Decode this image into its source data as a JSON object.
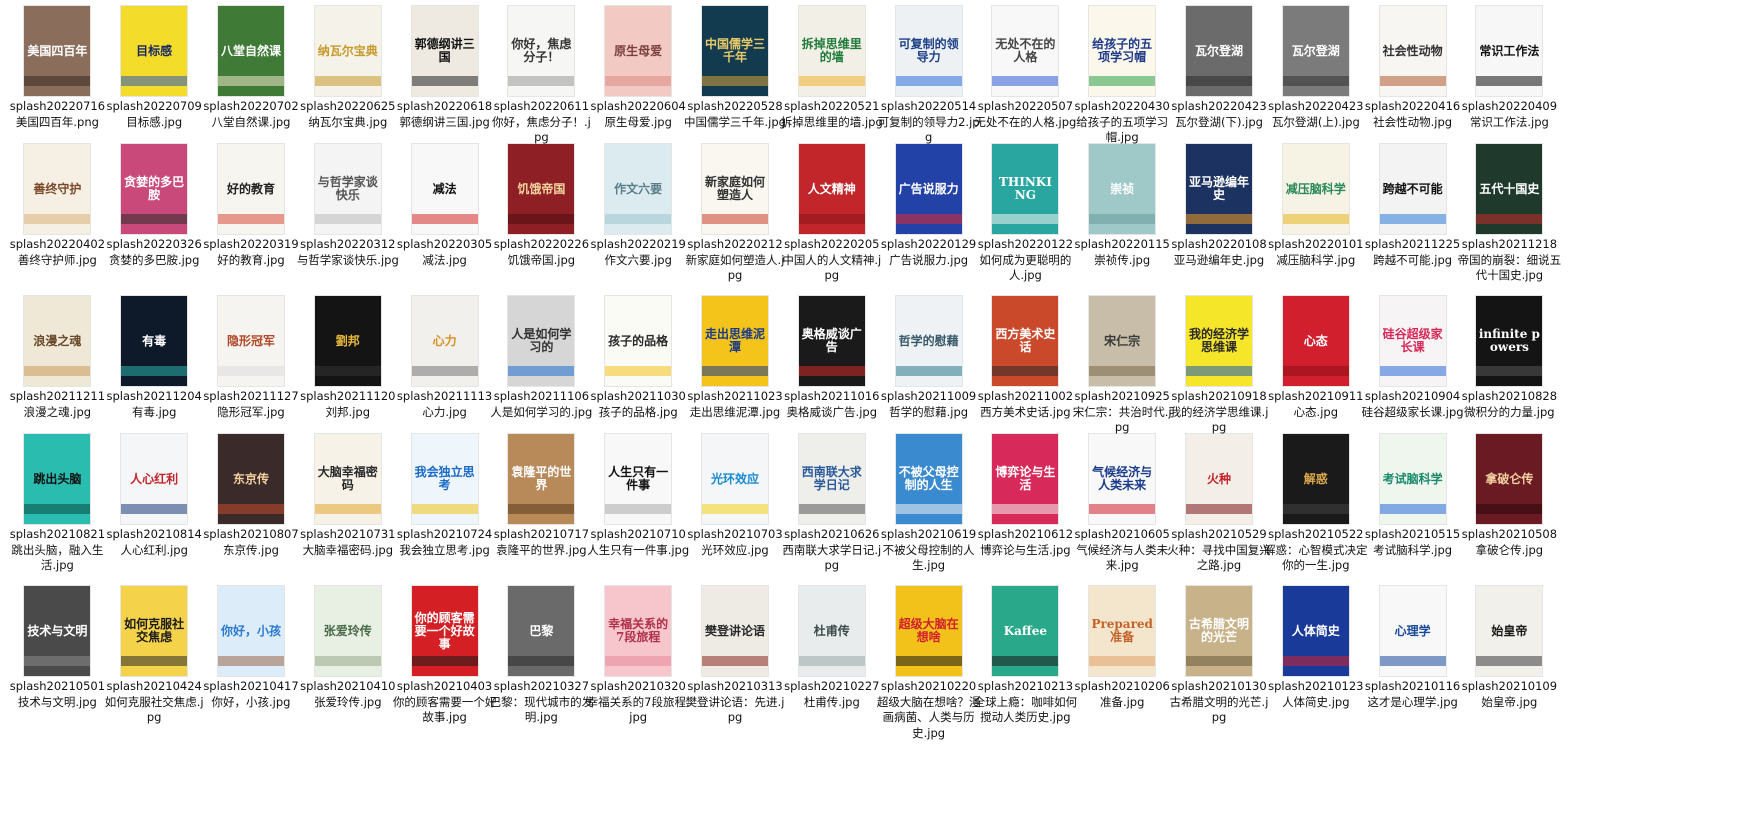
{
  "view": {
    "name": "file-grid",
    "row_count": 5,
    "column_count": 16
  },
  "files": [
    {
      "name": "splash20220716美国四百年.png",
      "cover_text": "美国四百年",
      "bg": "#8a6d5b",
      "fg": "#ffffff",
      "band": "#3b2a22"
    },
    {
      "name": "splash20220709目标感.jpg",
      "cover_text": "目标感",
      "bg": "#f3dc2a",
      "fg": "#1a2a66",
      "band": "#2a58b8"
    },
    {
      "name": "splash20220702八堂自然课.jpg",
      "cover_text": "八堂自然课",
      "bg": "#3f7a36",
      "fg": "#ffffff",
      "band": "#f2e8c8"
    },
    {
      "name": "splash20220625纳瓦尔宝典.jpg",
      "cover_text": "纳瓦尔宝典",
      "bg": "#f5f2ea",
      "fg": "#c79a2c",
      "band": "#c79a2c"
    },
    {
      "name": "splash20220618郭德纲讲三国.jpg",
      "cover_text": "郭德纲讲三国",
      "bg": "#eeeae2",
      "fg": "#111111",
      "band": "#222222"
    },
    {
      "name": "splash20220611你好，焦虑分子！.jpg",
      "cover_text": "你好，焦虑分子！",
      "bg": "#f6f6f4",
      "fg": "#333333",
      "band": "#999999"
    },
    {
      "name": "splash20220604原生母爱.jpg",
      "cover_text": "原生母爱",
      "bg": "#f3c9c4",
      "fg": "#7a3f3c",
      "band": "#d98a84"
    },
    {
      "name": "splash20220528中国儒学三千年.jpg",
      "cover_text": "中国儒学三千年",
      "bg": "#123b4f",
      "fg": "#e8c96a",
      "band": "#d9a23a"
    },
    {
      "name": "splash20220521拆掉思维里的墙.jpg",
      "cover_text": "拆掉思维里的墙",
      "bg": "#f1efe6",
      "fg": "#1f7b3a",
      "band": "#f0b22a"
    },
    {
      "name": "splash20220514可复制的领导力2.jpg",
      "cover_text": "可复制的领导力",
      "bg": "#eef1f4",
      "fg": "#1c3f86",
      "band": "#2b6fd8"
    },
    {
      "name": "splash20220507无处不在的人格.jpg",
      "cover_text": "无处不在的人格",
      "bg": "#f8f8f8",
      "fg": "#444444",
      "band": "#2f5bd2"
    },
    {
      "name": "splash20220430给孩子的五项学习帽.jpg",
      "cover_text": "给孩子的五项学习帽",
      "bg": "#fbf7ea",
      "fg": "#1e3a8a",
      "band": "#2ea04a"
    },
    {
      "name": "splash20220423瓦尔登湖(下).jpg",
      "cover_text": "瓦尔登湖",
      "bg": "#6b6b6b",
      "fg": "#ffffff",
      "band": "#2c2c2c"
    },
    {
      "name": "splash20220423瓦尔登湖(上).jpg",
      "cover_text": "瓦尔登湖",
      "bg": "#7b7b7b",
      "fg": "#ffffff",
      "band": "#333333"
    },
    {
      "name": "splash20220416社会性动物.jpg",
      "cover_text": "社会性动物",
      "bg": "#f8f6f2",
      "fg": "#333333",
      "band": "#b05a2e"
    },
    {
      "name": "splash20220409常识工作法.jpg",
      "cover_text": "常识工作法",
      "bg": "#f7f7f7",
      "fg": "#111111",
      "band": "#111111"
    },
    {
      "name": "splash20220402善终守护师.jpg",
      "cover_text": "善终守护",
      "bg": "#f6efe4",
      "fg": "#7a4a2a",
      "band": "#d9b27a"
    },
    {
      "name": "splash20220326贪婪的多巴胺.jpg",
      "cover_text": "贪婪的多巴胺",
      "bg": "#c9497a",
      "fg": "#ffffff",
      "band": "#2b2b2b"
    },
    {
      "name": "splash20220319好的教育.jpg",
      "cover_text": "好的教育",
      "bg": "#f7f5f0",
      "fg": "#222222",
      "band": "#d84a3a"
    },
    {
      "name": "splash20220312与哲学家谈快乐.jpg",
      "cover_text": "与哲学家谈快乐",
      "bg": "#f4f4f4",
      "fg": "#555555",
      "band": "#bbbbbb"
    },
    {
      "name": "splash20220305减法.jpg",
      "cover_text": "减法",
      "bg": "#f8f8f8",
      "fg": "#111111",
      "band": "#d42a2a"
    },
    {
      "name": "splash20220226饥饿帝国.jpg",
      "cover_text": "饥饿帝国",
      "bg": "#8e1f24",
      "fg": "#f2d5a0",
      "band": "#4a0d10"
    },
    {
      "name": "splash20220219作文六要.jpg",
      "cover_text": "作文六要",
      "bg": "#dcebf0",
      "fg": "#5a7d8a",
      "band": "#9cc4d0"
    },
    {
      "name": "splash20220212新家庭如何塑造人.jpg",
      "cover_text": "新家庭如何塑造人",
      "bg": "#faf6f0",
      "fg": "#333333",
      "band": "#c9402a"
    },
    {
      "name": "splash20220205中国人的人文精神.jpg",
      "cover_text": "人文精神",
      "bg": "#c2262a",
      "fg": "#ffffff",
      "band": "#8a1418"
    },
    {
      "name": "splash20220129广告说服力.jpg",
      "cover_text": "广告说服力",
      "bg": "#2242a8",
      "fg": "#ffffff",
      "band": "#e2282e"
    },
    {
      "name": "splash20220122如何成为更聪明的人.jpg",
      "cover_text": "THINKING",
      "bg": "#2aa6a0",
      "fg": "#ffffff",
      "band": "#f2f2f2"
    },
    {
      "name": "splash20220115崇祯传.jpg",
      "cover_text": "崇祯",
      "bg": "#9fc8c8",
      "fg": "#ffffff",
      "band": "#6a9a9a"
    },
    {
      "name": "splash20220108亚马逊编年史.jpg",
      "cover_text": "亚马逊编年史",
      "bg": "#1c3260",
      "fg": "#ffffff",
      "band": "#f29a1e"
    },
    {
      "name": "splash20220101减压脑科学.jpg",
      "cover_text": "减压脑科学",
      "bg": "#f6f2e4",
      "fg": "#2a8a5a",
      "band": "#e6b822"
    },
    {
      "name": "splash20211225跨越不可能.jpg",
      "cover_text": "跨越不可能",
      "bg": "#f3f3f3",
      "fg": "#111111",
      "band": "#2b7ad8"
    },
    {
      "name": "splash20211218帝国的崩裂：细说五代十国史.jpg",
      "cover_text": "五代十国史",
      "bg": "#1f3a2c",
      "fg": "#ffffff",
      "band": "#c22a2a"
    },
    {
      "name": "splash20211211浪漫之魂.jpg",
      "cover_text": "浪漫之魂",
      "bg": "#efe8d6",
      "fg": "#6a4a2a",
      "band": "#c99a5a"
    },
    {
      "name": "splash20211204有毒.jpg",
      "cover_text": "有毒",
      "bg": "#0e1a2a",
      "fg": "#ffffff",
      "band": "#2ab0a8"
    },
    {
      "name": "splash20211127隐形冠军.jpg",
      "cover_text": "隐形冠军",
      "bg": "#f6f4f0",
      "fg": "#b04a2a",
      "band": "#dddddd"
    },
    {
      "name": "splash20211120刘邦.jpg",
      "cover_text": "劉邦",
      "bg": "#141414",
      "fg": "#e6b83a",
      "band": "#333333"
    },
    {
      "name": "splash20211113心力.jpg",
      "cover_text": "心力",
      "bg": "#f2f0ec",
      "fg": "#d6922a",
      "band": "#777777"
    },
    {
      "name": "splash20211106人是如何学习的.jpg",
      "cover_text": "人是如何学习的",
      "bg": "#d6d6d6",
      "fg": "#333333",
      "band": "#1f6fd0"
    },
    {
      "name": "splash20211030孩子的品格.jpg",
      "cover_text": "孩子的品格",
      "bg": "#fbfbf6",
      "fg": "#2a2a2a",
      "band": "#f2c21a"
    },
    {
      "name": "splash20211023走出思维泥潭.jpg",
      "cover_text": "走出思维泥潭",
      "bg": "#f4c41a",
      "fg": "#1a3a8a",
      "band": "#1a3a8a"
    },
    {
      "name": "splash20211016奥格威谈广告.jpg",
      "cover_text": "奥格威谈广告",
      "bg": "#1a1a1a",
      "fg": "#ffffff",
      "band": "#d42a2a"
    },
    {
      "name": "splash20211009哲学的慰藉.jpg",
      "cover_text": "哲学的慰藉",
      "bg": "#eef2f4",
      "fg": "#3a5a6a",
      "band": "#2a7a8a"
    },
    {
      "name": "splash20211002西方美术史话.jpg",
      "cover_text": "西方美术史话",
      "bg": "#c9492a",
      "fg": "#ffffff",
      "band": "#2a2a2a"
    },
    {
      "name": "splash20210925宋仁宗：共治时代.jpg",
      "cover_text": "宋仁宗",
      "bg": "#c7bda8",
      "fg": "#3a3a3a",
      "band": "#7a6a4a"
    },
    {
      "name": "splash20210918我的经济学思维课.jpg",
      "cover_text": "我的经济学思维课",
      "bg": "#f6e62a",
      "fg": "#2a2a2a",
      "band": "#1a5ab8"
    },
    {
      "name": "splash20210911心态.jpg",
      "cover_text": "心态",
      "bg": "#d21f2e",
      "fg": "#ffffff",
      "band": "#8a0f18"
    },
    {
      "name": "splash20210904硅谷超级家长课.jpg",
      "cover_text": "硅谷超级家长课",
      "bg": "#f6f4f4",
      "fg": "#d62a5a",
      "band": "#2a6ad8"
    },
    {
      "name": "splash20210828微积分的力量.jpg",
      "cover_text": "infinite powers",
      "bg": "#141414",
      "fg": "#ffffff",
      "band": "#555555"
    },
    {
      "name": "splash20210821跳出头脑，融入生活.jpg",
      "cover_text": "跳出头脑",
      "bg": "#2abcae",
      "fg": "#111111",
      "band": "#0a4a44"
    },
    {
      "name": "splash20210814人心红利.jpg",
      "cover_text": "人心红利",
      "bg": "#f4f6f8",
      "fg": "#c2262a",
      "band": "#1a3a7a"
    },
    {
      "name": "splash20210807东京传.jpg",
      "cover_text": "东京传",
      "bg": "#3a2a2a",
      "fg": "#f2d0a0",
      "band": "#c24a2a"
    },
    {
      "name": "splash20210731大脑幸福密码.jpg",
      "cover_text": "大脑幸福密码",
      "bg": "#f6f2e8",
      "fg": "#2a2a2a",
      "band": "#e2a82a"
    },
    {
      "name": "splash20210724我会独立思考.jpg",
      "cover_text": "我会独立思考",
      "bg": "#eef6fc",
      "fg": "#1a6ac8",
      "band": "#f2c21a"
    },
    {
      "name": "splash20210717袁隆平的世界.jpg",
      "cover_text": "袁隆平的世界",
      "bg": "#b88a5a",
      "fg": "#ffffff",
      "band": "#5a3a1a"
    },
    {
      "name": "splash20210710人生只有一件事.jpg",
      "cover_text": "人生只有一件事",
      "bg": "#f8f8f8",
      "fg": "#111111",
      "band": "#aaaaaa"
    },
    {
      "name": "splash20210703光环效应.jpg",
      "cover_text": "光环效应",
      "bg": "#f4f6f8",
      "fg": "#1a8ad0",
      "band": "#f2d21a"
    },
    {
      "name": "splash20210626西南联大求学日记.jpg",
      "cover_text": "西南联大求学日记",
      "bg": "#eeeeea",
      "fg": "#2a5a9a",
      "band": "#555555"
    },
    {
      "name": "splash20210619不被父母控制的人生.jpg",
      "cover_text": "不被父母控制的人生",
      "bg": "#3a8ad0",
      "fg": "#ffffff",
      "band": "#f2f2f2"
    },
    {
      "name": "splash20210612博弈论与生活.jpg",
      "cover_text": "博弈论与生活",
      "bg": "#d82a5a",
      "fg": "#ffffff",
      "band": "#f2f2f2"
    },
    {
      "name": "splash20210605气候经济与人类未来.jpg",
      "cover_text": "气候经济与人类未来",
      "bg": "#f8f8f8",
      "fg": "#1a3a8a",
      "band": "#d21f2e"
    },
    {
      "name": "splash20210529火种：寻找中国复兴之路.jpg",
      "cover_text": "火种",
      "bg": "#f4eee8",
      "fg": "#c2262a",
      "band": "#7a1418"
    },
    {
      "name": "splash20210522解惑：心智模式决定你的一生.jpg",
      "cover_text": "解惑",
      "bg": "#1a1a1a",
      "fg": "#d8a84a",
      "band": "#444444"
    },
    {
      "name": "splash20210515考试脑科学.jpg",
      "cover_text": "考试脑科学",
      "bg": "#eef6ee",
      "fg": "#1a8a6a",
      "band": "#2a6ad8"
    },
    {
      "name": "splash20210508拿破仑传.jpg",
      "cover_text": "拿破仑传",
      "bg": "#6a1a22",
      "fg": "#f2d0a0",
      "band": "#2a0a0e"
    },
    {
      "name": "splash20210501技术与文明.jpg",
      "cover_text": "技术与文明",
      "bg": "#4a4a4a",
      "fg": "#ffffff",
      "band": "#8a8a8a"
    },
    {
      "name": "splash20210424如何克服社交焦虑.jpg",
      "cover_text": "如何克服社交焦虑",
      "bg": "#f4d24a",
      "fg": "#1a1a1a",
      "band": "#2a2a2a"
    },
    {
      "name": "splash20210417你好，小孩.jpg",
      "cover_text": "你好，小孩",
      "bg": "#dcecf8",
      "fg": "#2a7ad0",
      "band": "#9a6a4a"
    },
    {
      "name": "splash20210410张爱玲传.jpg",
      "cover_text": "张爱玲传",
      "bg": "#e8f0e4",
      "fg": "#4a6a4a",
      "band": "#9aaa8a"
    },
    {
      "name": "splash20210403你的顾客需要一个好故事.jpg",
      "cover_text": "你的顾客需要一个好故事",
      "bg": "#d41f24",
      "fg": "#ffffff",
      "band": "#1a1a1a"
    },
    {
      "name": "splash20210327巴黎：现代城市的发明.jpg",
      "cover_text": "巴黎",
      "bg": "#6a6a6a",
      "fg": "#ffffff",
      "band": "#2a2a2a"
    },
    {
      "name": "splash20210320幸福关系的7段旅程.jpg",
      "cover_text": "幸福关系的7段旅程",
      "bg": "#f6c6cc",
      "fg": "#b0304a",
      "band": "#e88a9a"
    },
    {
      "name": "splash20210313樊登讲论语：先进.jpg",
      "cover_text": "樊登讲论语",
      "bg": "#eeeae4",
      "fg": "#2a2a2a",
      "band": "#8a2a22"
    },
    {
      "name": "splash20210227杜甫传.jpg",
      "cover_text": "杜甫传",
      "bg": "#e8ecec",
      "fg": "#3a4a4a",
      "band": "#9aaaaa"
    },
    {
      "name": "splash20210220超级大脑在想啥？漫画病菌、人类与历史.jpg",
      "cover_text": "超级大脑在想啥",
      "bg": "#f2c21a",
      "fg": "#d21f2e",
      "band": "#1a1a1a"
    },
    {
      "name": "splash20210213全球上瘾：咖啡如何搅动人类历史.jpg",
      "cover_text": "Kaffee",
      "bg": "#2aa88a",
      "fg": "#ffffff",
      "band": "#1a1a1a"
    },
    {
      "name": "splash20210206准备.jpg",
      "cover_text": "Prepared 准备",
      "bg": "#f4e6cc",
      "fg": "#c2622a",
      "band": "#e2a26a"
    },
    {
      "name": "splash20210130古希腊文明的光芒.jpg",
      "cover_text": "古希腊文明的光芒",
      "bg": "#c8b28a",
      "fg": "#ffffff",
      "band": "#6a5a3a"
    },
    {
      "name": "splash20210123人体简史.jpg",
      "cover_text": "人体简史",
      "bg": "#1a3a9a",
      "fg": "#ffffff",
      "band": "#d21f2e"
    },
    {
      "name": "splash20210116这才是心理学.jpg",
      "cover_text": "心理学",
      "bg": "#f8f8f8",
      "fg": "#1a4a9a",
      "band": "#1a4a9a"
    },
    {
      "name": "splash20210109始皇帝.jpg",
      "cover_text": "始皇帝",
      "bg": "#f2f0ea",
      "fg": "#1a1a1a",
      "band": "#3a3a3a"
    }
  ]
}
